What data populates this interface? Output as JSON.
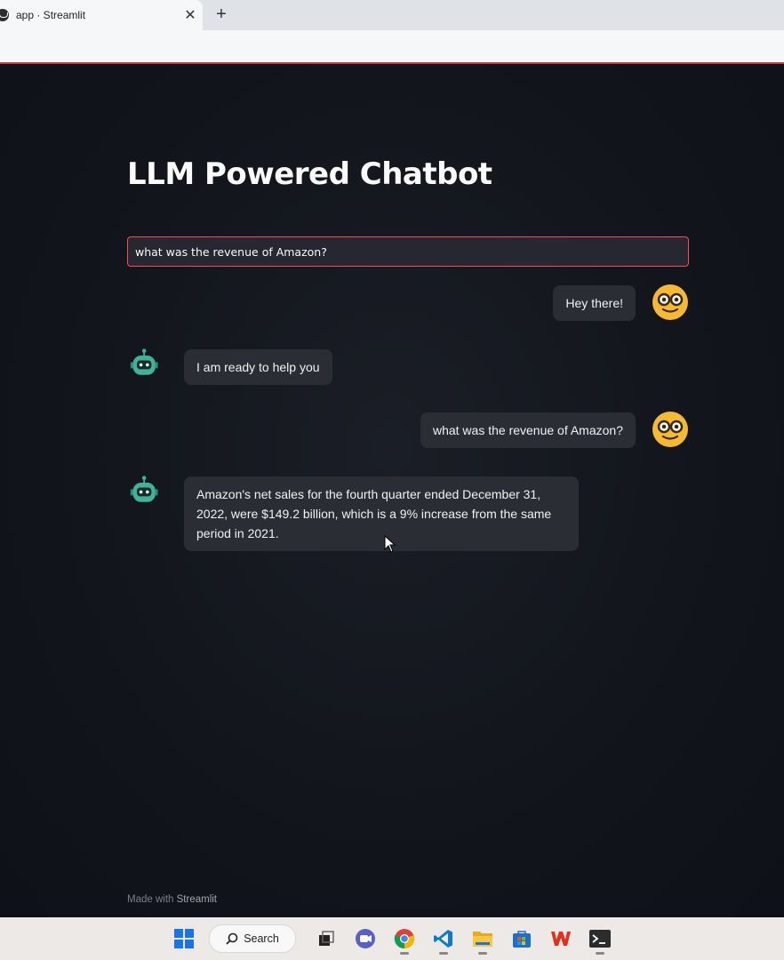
{
  "browser": {
    "tab_title": "app · Streamlit",
    "close_glyph": "✕",
    "new_tab_glyph": "+"
  },
  "app": {
    "title": "LLM Powered Chatbot",
    "input_value": "what was the revenue of Amazon?",
    "messages": [
      {
        "role": "user",
        "avatar": "nerd-face-icon",
        "text": "Hey there!"
      },
      {
        "role": "assistant",
        "avatar": "robot-icon",
        "text": "I am ready to help you"
      },
      {
        "role": "user",
        "avatar": "nerd-face-icon",
        "text": "what was the revenue of Amazon?"
      },
      {
        "role": "assistant",
        "avatar": "robot-icon",
        "text": "Amazon's net sales for the fourth quarter ended December 31, 2022, were $149.2 billion, which is a 9% increase from the same period in 2021."
      }
    ],
    "footer_prefix": "Made with",
    "footer_brand": "Streamlit"
  },
  "taskbar": {
    "search_label": "Search",
    "apps": [
      "windows-start-icon",
      "search",
      "task-view-icon",
      "chat-icon",
      "chrome-icon",
      "vscode-icon",
      "file-explorer-icon",
      "store-icon",
      "wps-office-icon",
      "terminal-icon"
    ]
  },
  "colors": {
    "background": "#0e1117",
    "bubble": "#2b2d35",
    "accent": "#ff4b4b",
    "user_avatar": "#f5b932",
    "bot_avatar": "#3fb39a"
  }
}
